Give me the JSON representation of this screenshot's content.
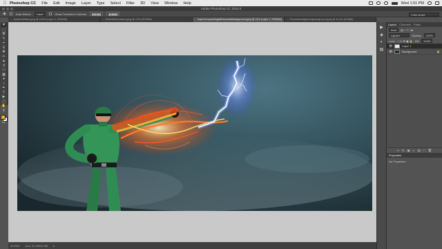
{
  "menubar": {
    "app": "Photoshop CC",
    "menus": [
      "File",
      "Edit",
      "Image",
      "Layer",
      "Type",
      "Select",
      "Filter",
      "3D",
      "View",
      "Window",
      "Help"
    ],
    "clock": "Wed 1:51 PM"
  },
  "window": {
    "title": "Adobe Photoshop CC 2015.5"
  },
  "options": {
    "auto_select": "Auto-Select:",
    "layer_select": "Layer",
    "show_transform": "Show Transform Controls",
    "workspace": "Colin smart"
  },
  "tabs": [
    "SplashofWater.jpeg @ 100% (Layer 0, RGB/8#)",
    "Relaxwithmessele.jpeg @ 13% (RGB/8#)",
    "Superheropointingwithdramaticbackground.jpeg @ 31% (Layer 1, RGB/8#)",
    "Firewallsandlightningbackground.jpeg @ 43.4% (RGB/8)"
  ],
  "status": {
    "zoom": "30.96%",
    "doc": "Doc: 20.3M/40.5M"
  },
  "panel": {
    "tabs": [
      "Layers",
      "Channels",
      "Paths"
    ],
    "kind": "Kind",
    "blend_mode": "Lighten",
    "opacity_label": "Opacity:",
    "opacity_value": "100%",
    "lock_label": "Lock:",
    "fill_label": "Fill:",
    "fill_value": "100%",
    "layers": [
      {
        "name": "Layer 1",
        "selected": true
      },
      {
        "name": "Background",
        "selected": false
      }
    ],
    "properties_title": "Properties",
    "properties_empty": "No Properties"
  },
  "colors": {
    "foreground": "#e1b21a",
    "background": "#ffffff",
    "canvas_bg": "#c9c9c9",
    "sky_dark": "#1a282d",
    "sky_light": "#4d7483",
    "suit": "#2f8d54",
    "fire": "#ff5a1f",
    "lightning": "#9fb6ff"
  }
}
